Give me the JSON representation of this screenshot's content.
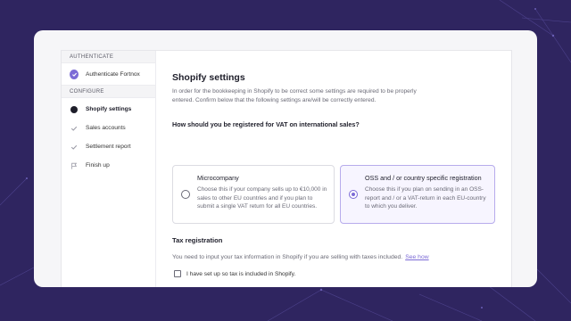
{
  "sidebar": {
    "section_authenticate": "AUTHENTICATE",
    "section_configure": "CONFIGURE",
    "authenticate_item": "Authenticate Fortnox",
    "steps": [
      {
        "label": "Shopify settings",
        "state": "current"
      },
      {
        "label": "Sales accounts",
        "state": "pending"
      },
      {
        "label": "Settlement report",
        "state": "pending"
      },
      {
        "label": "Finish up",
        "state": "flag"
      }
    ]
  },
  "main": {
    "title": "Shopify settings",
    "intro": "In order for the bookkeeping in Shopify to be correct some settings are required to be properly entered. Confirm below that the following settings are/will be correctly entered.",
    "vat_question": "How should you be registered for VAT on international sales?",
    "options": [
      {
        "title": "Microcompany",
        "description": "Choose this if your company sells up to €10,000 in sales to other EU countries and if you plan to submit a single VAT return for all EU countries.",
        "selected": false
      },
      {
        "title": "OSS and / or country specific registration",
        "description": "Choose this if you plan on sending in an OSS-report and / or a VAT-return in each EU-country to which you deliver.",
        "selected": true
      }
    ],
    "tax_heading": "Tax registration",
    "tax_text": "You need to input your tax information in Shopify if you are selling with taxes included.",
    "tax_link": "See how",
    "checkbox_label": "I have set up so tax is included in Shopify."
  },
  "colors": {
    "background": "#2f2560",
    "accent": "#7c6bd6"
  }
}
